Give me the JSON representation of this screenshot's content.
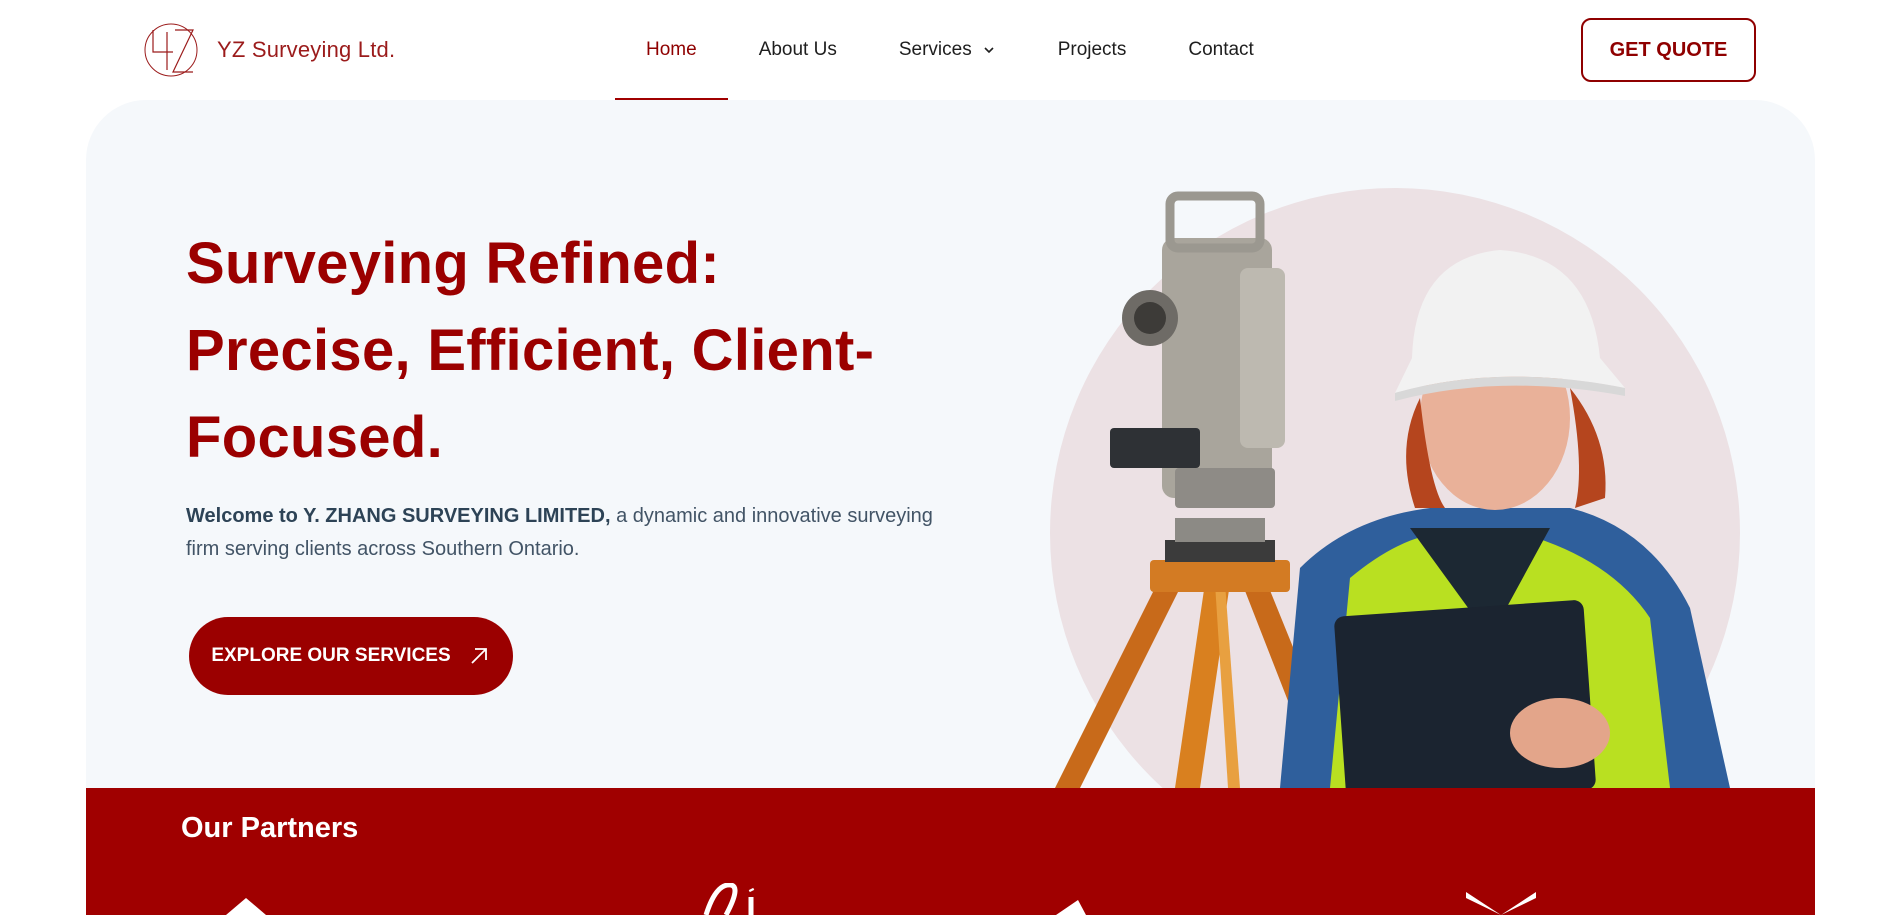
{
  "brand": {
    "name": "YZ Surveying Ltd.",
    "logo_icon": "yz-monogram-icon"
  },
  "nav": {
    "items": [
      {
        "label": "Home",
        "active": true
      },
      {
        "label": "About Us",
        "active": false
      },
      {
        "label": "Services",
        "active": false,
        "has_dropdown": true
      },
      {
        "label": "Projects",
        "active": false
      },
      {
        "label": "Contact",
        "active": false
      }
    ],
    "quote_label": "GET QUOTE"
  },
  "hero": {
    "title_lines": [
      "Surveying Refined:",
      "Precise, Efficient, Client-",
      "Focused."
    ],
    "desc_bold": "Welcome to Y. ZHANG SURVEYING LIMITED,",
    "desc_rest": " a dynamic and innovative surveying firm serving clients across Southern Ontario.",
    "cta_label": "EXPLORE OUR SERVICES",
    "cta_icon": "arrow-up-right-icon"
  },
  "partners": {
    "title": "Our Partners"
  },
  "colors": {
    "brand": "#9b0000",
    "hero_bg": "#f5f8fb",
    "circle": "#ece1e4",
    "partners_bg": "#a00000"
  }
}
